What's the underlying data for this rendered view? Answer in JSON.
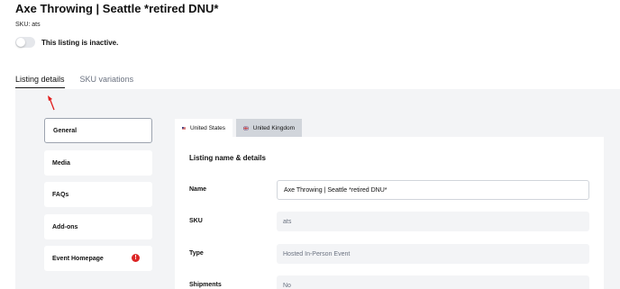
{
  "header": {
    "title": "Axe Throwing | Seattle *retired DNU*",
    "sku_line": "SKU: ats",
    "status_text": "This listing is inactive.",
    "active": false
  },
  "tabs": [
    {
      "label": "Listing details",
      "active": true
    },
    {
      "label": "SKU variations",
      "active": false
    }
  ],
  "sidebar": {
    "items": [
      {
        "label": "General",
        "active": true,
        "alert": false
      },
      {
        "label": "Media",
        "active": false,
        "alert": false
      },
      {
        "label": "FAQs",
        "active": false,
        "alert": false
      },
      {
        "label": "Add-ons",
        "active": false,
        "alert": false
      },
      {
        "label": "Event Homepage",
        "active": false,
        "alert": true
      }
    ],
    "alert_glyph": "!"
  },
  "locale_tabs": [
    {
      "label": "United States",
      "flag": "us-flag",
      "active": true
    },
    {
      "label": "United Kingdom",
      "flag": "uk-flag",
      "active": false
    }
  ],
  "form": {
    "section_title": "Listing name & details",
    "fields": [
      {
        "label": "Name",
        "value": "Axe Throwing | Seattle *retired DNU*",
        "editable": true
      },
      {
        "label": "SKU",
        "value": "ats",
        "editable": false
      },
      {
        "label": "Type",
        "value": "Hosted In-Person Event",
        "editable": false
      },
      {
        "label": "Shipments",
        "value": "No",
        "editable": false
      }
    ]
  },
  "colors": {
    "panel_bg": "#f3f4f6",
    "alert": "#dc2626",
    "annotation_arrow": "#e11d1d"
  }
}
